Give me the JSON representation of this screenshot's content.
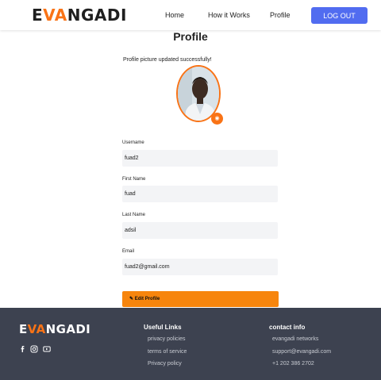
{
  "header": {
    "logo": {
      "left": "E",
      "mid": "VA",
      "right": "NGADI"
    },
    "nav": [
      "Home",
      "How it Works",
      "Profile"
    ],
    "logout_label": "LOG OUT"
  },
  "main": {
    "title": "Profile",
    "success_message": "Profile picture updated successfully!",
    "fields": [
      {
        "label": "Username",
        "value": "fuad2"
      },
      {
        "label": "First Name",
        "value": "fuad"
      },
      {
        "label": "Last Name",
        "value": "adsil"
      },
      {
        "label": "Email",
        "value": "fuad2@gmail.com"
      }
    ],
    "edit_label": "Edit Profile"
  },
  "footer": {
    "logo": {
      "left": "E",
      "mid": "VA",
      "right": "NGADI"
    },
    "social_icons": [
      "facebook-icon",
      "instagram-icon",
      "youtube-icon"
    ],
    "useful_links": {
      "heading": "Useful Links",
      "items": [
        "privacy policies",
        "terms of service",
        "Privacy policy"
      ]
    },
    "contact": {
      "heading": "contact info",
      "items": [
        "evangadi networks",
        "support@evangadi.com",
        "+1 202 386 2702"
      ]
    }
  },
  "colors": {
    "accent": "#f97316",
    "logout": "#516cf0",
    "footer_bg": "#3d4250"
  }
}
